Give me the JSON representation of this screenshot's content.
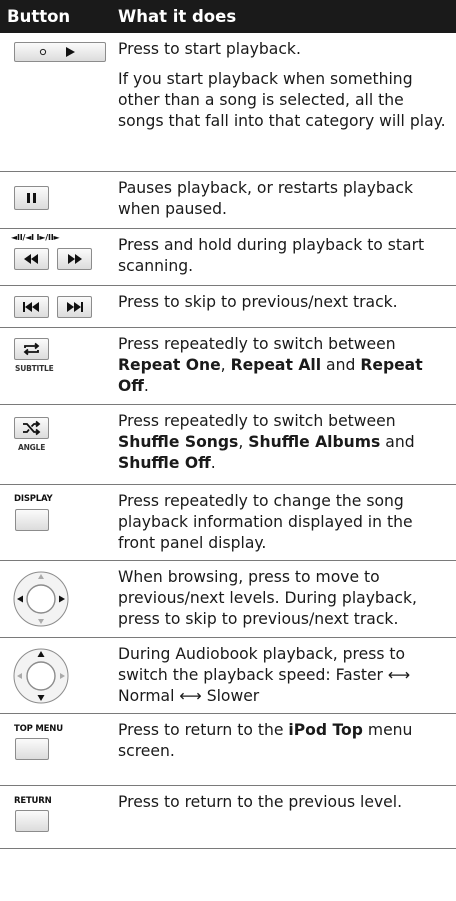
{
  "header": {
    "col_button": "Button",
    "col_what": "What it does"
  },
  "rows": [
    {
      "paras": [
        "Press to start playback.",
        "If you start playback when something other than a song is selected, all the songs that fall into that category will play."
      ]
    },
    {
      "paras": [
        "Pauses playback, or restarts playback when paused."
      ]
    },
    {
      "top_label": "◄II/◄I I►/II►",
      "paras": [
        "Press and hold during playback to start scanning."
      ]
    },
    {
      "paras": [
        "Press to skip to previous/next track."
      ]
    },
    {
      "sub_label": "SUBTITLE",
      "pre": "Press repeatedly to switch between ",
      "b1": "Repeat One",
      "sep1": ", ",
      "b2": "Repeat All",
      "sep2": " and ",
      "b3": "Repeat Off",
      "post": "."
    },
    {
      "sub_label": "ANGLE",
      "pre": "Press repeatedly to switch between ",
      "b1": "Shuffle Songs",
      "sep1": ", ",
      "b2": "Shuffle Albums",
      "sep2": " and ",
      "b3": "Shuffle Off",
      "post": "."
    },
    {
      "top_label": "DISPLAY",
      "paras": [
        "Press repeatedly to change the song playback information displayed in the front panel display."
      ]
    },
    {
      "paras": [
        "When browsing, press to move to previous/next levels. During playback, press to skip to previous/next track."
      ]
    },
    {
      "line1": "During Audiobook playback, press to switch the playback speed: Faster ⟷",
      "line2": "Normal ⟷ Slower"
    },
    {
      "top_label": "TOP MENU",
      "pre": "Press to return to the ",
      "b1": "iPod Top",
      "post": " menu screen."
    },
    {
      "top_label": "RETURN",
      "paras": [
        "Press to return to the previous level."
      ]
    }
  ]
}
